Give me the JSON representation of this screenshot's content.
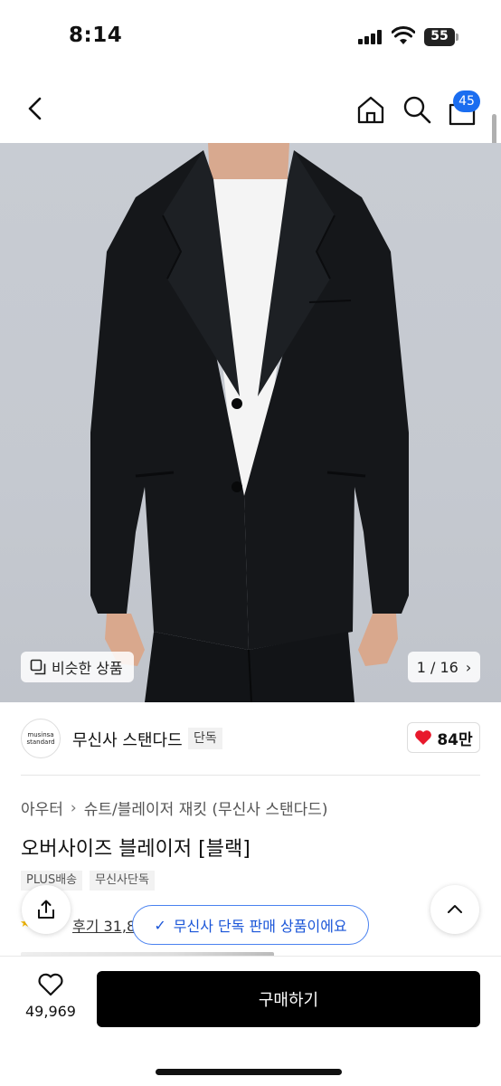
{
  "status_bar": {
    "time": "8:14",
    "battery": "55",
    "icons": [
      "signal-icon",
      "wifi-icon",
      "battery-icon"
    ]
  },
  "nav": {
    "icons": [
      "back-icon",
      "home-icon",
      "search-icon",
      "cart-icon"
    ],
    "cart_count": "45"
  },
  "hero": {
    "similar_label": "비슷한 상품",
    "page_counter": "1 / 16"
  },
  "brand": {
    "logo_line1": "musinsa",
    "logo_line2": "standard",
    "name": "무신사 스탠다드",
    "tag": "단독",
    "likes": "84만"
  },
  "product": {
    "breadcrumb": [
      "아우터",
      "슈트/블레이저 재킷 (무신사 스탠다드)"
    ],
    "title": "오버사이즈 블레이저 [블랙]",
    "tags": [
      "PLUS배송",
      "무신사단독"
    ],
    "review_text": "후기 31,8",
    "exclusive_toast": "무신사 단독 판매 상품이에요"
  },
  "bottom": {
    "wish_count": "49,969",
    "buy_label": "구매하기"
  },
  "colors": {
    "accent": "#1a6df0",
    "like": "#e8192c",
    "toast_border": "#4a82f0",
    "buy_bg": "#000000"
  }
}
